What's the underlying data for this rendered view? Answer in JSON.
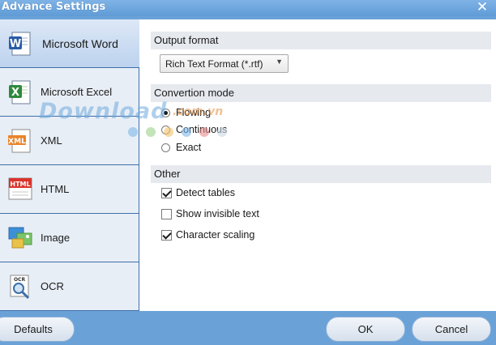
{
  "window": {
    "title": "Advance Settings",
    "close_symbol": "✕",
    "accent_color": "#6aa2d8"
  },
  "sidebar": {
    "items": [
      {
        "label": "Microsoft Word",
        "icon": "word-icon",
        "active": true
      },
      {
        "label": "Microsoft Excel",
        "icon": "excel-icon",
        "active": false
      },
      {
        "label": "XML",
        "icon": "xml-icon",
        "active": false
      },
      {
        "label": "HTML",
        "icon": "html-icon",
        "active": false
      },
      {
        "label": "Image",
        "icon": "image-icon",
        "active": false
      },
      {
        "label": "OCR",
        "icon": "ocr-icon",
        "active": false
      }
    ]
  },
  "output_format": {
    "heading": "Output format",
    "selected": "Rich Text Format (*.rtf)"
  },
  "convertion_mode": {
    "heading": "Convertion mode",
    "options": [
      {
        "label": "Flowing",
        "checked": true
      },
      {
        "label": "Continuous",
        "checked": false
      },
      {
        "label": "Exact",
        "checked": false
      }
    ]
  },
  "other": {
    "heading": "Other",
    "options": [
      {
        "label": "Detect tables",
        "checked": true
      },
      {
        "label": "Show invisible text",
        "checked": false
      },
      {
        "label": "Character scaling",
        "checked": true
      }
    ]
  },
  "footer": {
    "defaults_label": "Defaults",
    "ok_label": "OK",
    "cancel_label": "Cancel"
  },
  "watermark": {
    "text": "Download",
    "suffix": ".com.vn",
    "dot_colors": [
      "#7fb8e8",
      "#9dd08a",
      "#f2c16a",
      "#7fb8e8",
      "#e98c8c",
      "#c9d7e8"
    ]
  }
}
